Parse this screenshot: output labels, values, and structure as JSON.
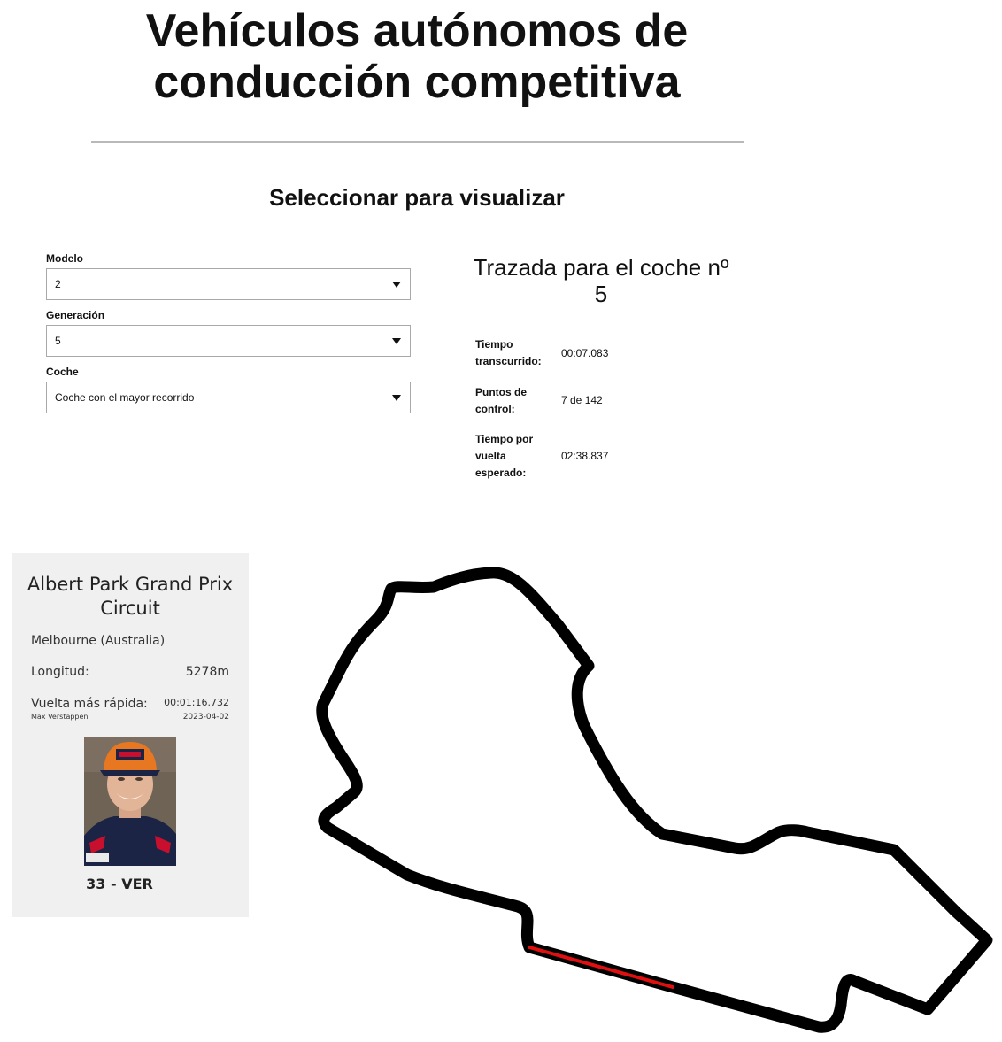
{
  "page": {
    "title": "Vehículos autónomos de conducción competitiva",
    "section_title": "Seleccionar para visualizar"
  },
  "selectors": {
    "model": {
      "label": "Modelo",
      "value": "2"
    },
    "generation": {
      "label": "Generación",
      "value": "5"
    },
    "car": {
      "label": "Coche",
      "value": "Coche con el mayor recorrido"
    }
  },
  "trace": {
    "title": "Trazada para el coche nº 5",
    "stats": [
      {
        "label": "Tiempo transcurrido:",
        "value": "00:07.083"
      },
      {
        "label": "Puntos de control:",
        "value": "7 de 142"
      },
      {
        "label": "Tiempo por vuelta esperado:",
        "value": "02:38.837"
      }
    ]
  },
  "circuit": {
    "name": "Albert Park Grand Prix Circuit",
    "location": "Melbourne (Australia)",
    "length_label": "Longitud:",
    "length_value": "5278m",
    "fastest_lap_label": "Vuelta más rápida:",
    "fastest_lap_time": "00:01:16.732",
    "fastest_lap_driver": "Max Verstappen",
    "fastest_lap_date": "2023-04-02",
    "driver_tag": "33 - VER",
    "photo_icon": "driver-portrait",
    "track_color": "#000000",
    "progress_color": "#e01010"
  }
}
